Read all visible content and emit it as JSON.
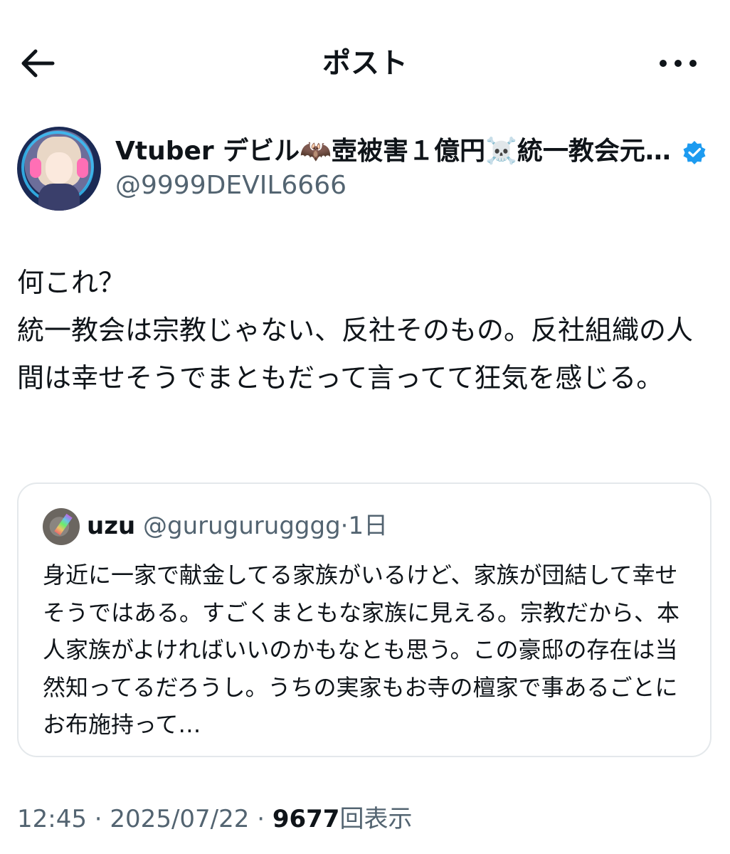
{
  "header": {
    "title": "ポスト",
    "back_icon": "arrow-left-icon",
    "more_icon": "more-horizontal-icon"
  },
  "author": {
    "display_name": "Vtuber デビル🦇壺被害１億円☠️統一教会元…",
    "handle": "@9999DEVIL6666",
    "verified_color": "#1d9bf0"
  },
  "post": {
    "text": "何これ？\n統一教会は宗教じゃない、反社そのもの。反社組織の人間は幸せそうでまともだって言ってて狂気を感じる。"
  },
  "quote": {
    "name": "uzu",
    "handle": "@gurugurugggg",
    "separator": "·",
    "time": "1日",
    "text": "身近に一家で献金してる家族がいるけど、家族が団結して幸せそうではある。すごくまともな家族に見える。宗教だから、本人家族がよければいいのかもなとも思う。この豪邸の存在は当然知ってるだろうし。うちの実家もお寺の檀家で事あるごとにお布施持って…"
  },
  "meta": {
    "time": "12:45",
    "sep1": " · ",
    "date": "2025/07/22",
    "sep2": " · ",
    "views": "9677",
    "views_label": "回表示"
  }
}
